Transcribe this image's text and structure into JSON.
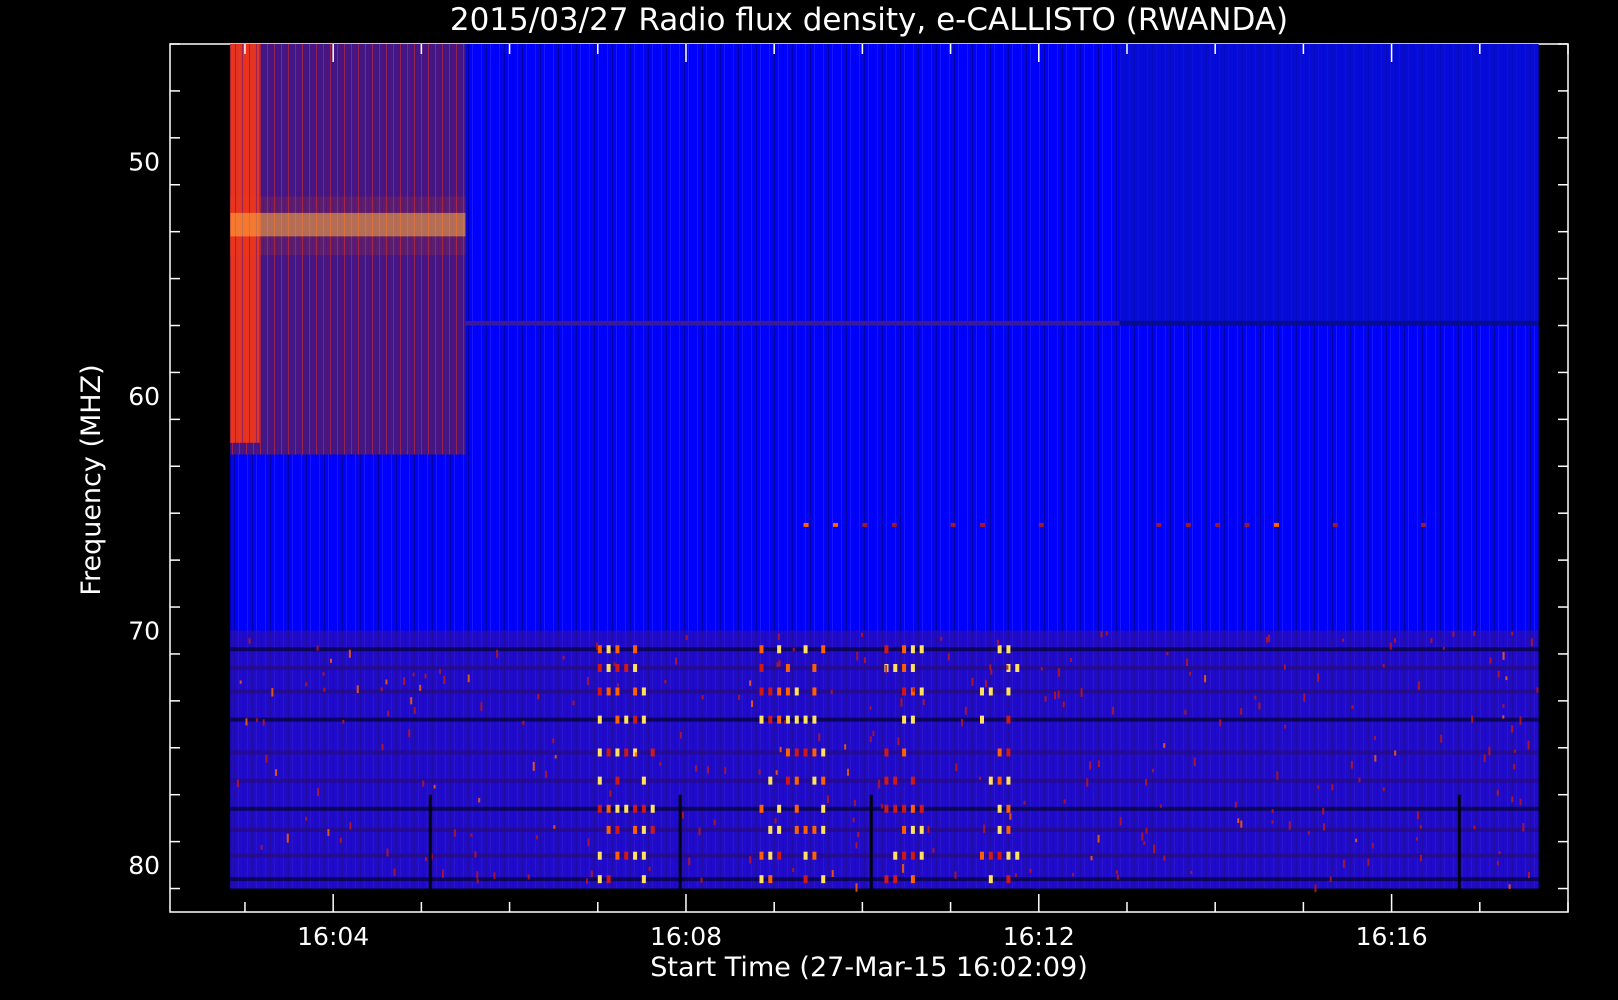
{
  "chart_data": {
    "type": "heatmap",
    "title": "2015/03/27  Radio flux density, e-CALLISTO (RWANDA)",
    "xlabel": "Start Time (27-Mar-15 16:02:09)",
    "ylabel": "Frequency (MHZ)",
    "x_unit": "time (HH:MM, 27-Mar-2015)",
    "xlim": [
      "16:02:09",
      "16:18:00"
    ],
    "data_time_range": [
      "16:02:50",
      "16:17:40"
    ],
    "ylim": [
      45,
      82
    ],
    "y_inverted": true,
    "data_freq_range": [
      45,
      81
    ],
    "x_ticks": [
      "16:04",
      "16:08",
      "16:12",
      "16:16"
    ],
    "y_ticks": [
      50,
      60,
      70,
      80
    ],
    "colormap": {
      "low": "#0000ff",
      "mid_low": "#3a1a9a",
      "mid": "#b01010",
      "high": "#ff6000",
      "max": "#ffe060",
      "saturated_low": "#000010"
    },
    "features": [
      {
        "name": "strong emission band",
        "time": [
          "16:02:50",
          "16:05:30"
        ],
        "freq": [
          51.5,
          54
        ],
        "level": "high"
      },
      {
        "name": "elevated background",
        "time": [
          "16:02:50",
          "16:05:30"
        ],
        "freq": [
          45,
          62.5
        ],
        "level": "mid"
      },
      {
        "name": "edge spikes",
        "time": [
          "16:02:50",
          "16:03:10"
        ],
        "freq": [
          45,
          62
        ],
        "level": "max"
      },
      {
        "name": "horizontal line",
        "time": [
          "16:05:30",
          "16:12:55"
        ],
        "freq": [
          56.8,
          57
        ],
        "level": "mid_low"
      },
      {
        "name": "horizontal dark line",
        "time": [
          "16:12:55",
          "16:17:40"
        ],
        "freq": [
          56.8,
          57
        ],
        "level": "saturated_low"
      },
      {
        "name": "darker block",
        "time": [
          "16:12:55",
          "16:17:40"
        ],
        "freq": [
          45,
          57
        ],
        "level": "mid_low"
      },
      {
        "name": "RFI band region",
        "time": [
          "16:02:50",
          "16:17:40"
        ],
        "freq": [
          70,
          81
        ],
        "level": "mid"
      },
      {
        "name": "intermittent RFI",
        "time": [
          "16:08:30",
          "16:11:50"
        ],
        "freq": [
          70,
          81
        ],
        "level": "max"
      }
    ]
  }
}
